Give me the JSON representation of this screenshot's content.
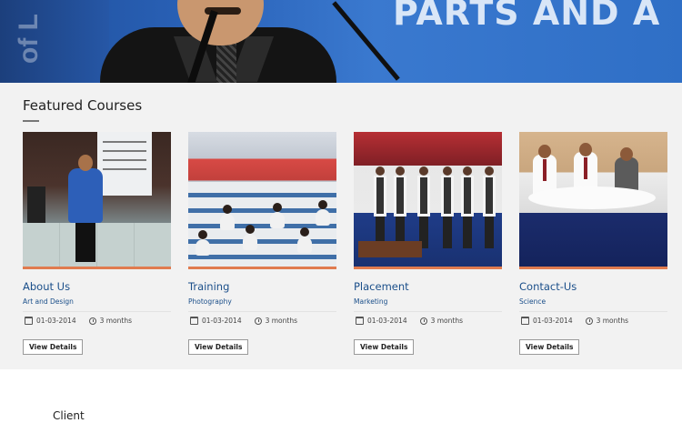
{
  "hero": {
    "vertical_text": "of L",
    "banner_text": "PARTS AND A"
  },
  "featured": {
    "title": "Featured Courses",
    "courses": [
      {
        "name": "About Us",
        "category": "Art and Design",
        "date": "01-03-2014",
        "duration": "3 months",
        "button_label": "View Details"
      },
      {
        "name": "Training",
        "category": "Photography",
        "date": "01-03-2014",
        "duration": "3 months",
        "button_label": "View Details"
      },
      {
        "name": "Placement",
        "category": "Marketing",
        "date": "01-03-2014",
        "duration": "3 months",
        "button_label": "View Details"
      },
      {
        "name": "Contact-Us",
        "category": "Science",
        "date": "01-03-2014",
        "duration": "3 months",
        "button_label": "View Details"
      }
    ]
  },
  "client": {
    "title": "Client"
  },
  "colors": {
    "accent_link": "#1b4f8a",
    "thumb_underline": "#e07b4f",
    "section_bg": "#f2f2f2",
    "hero_blue": "#2a62b8"
  },
  "icons": [
    "calendar-icon",
    "clock-icon"
  ]
}
